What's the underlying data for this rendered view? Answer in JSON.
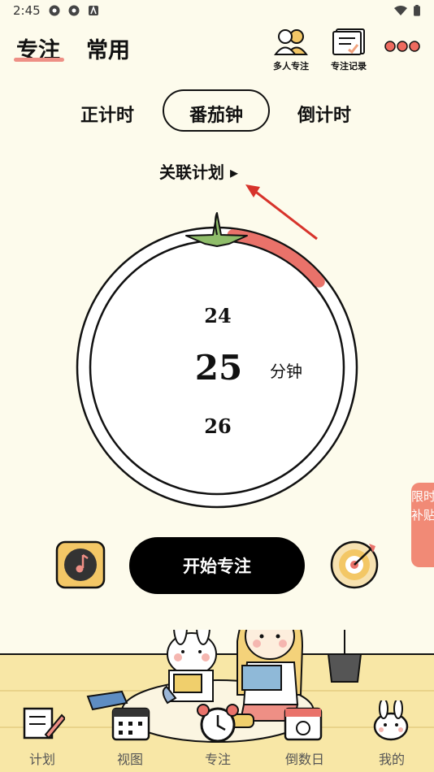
{
  "status_bar": {
    "time": "2:45"
  },
  "header": {
    "tabs": [
      {
        "label": "专注"
      },
      {
        "label": "常用"
      }
    ],
    "multi_person_label": "多人专注",
    "focus_record_label": "专注记录"
  },
  "modes": [
    {
      "label": "正计时"
    },
    {
      "label": "番茄钟"
    },
    {
      "label": "倒计时"
    }
  ],
  "linked_plan": "关联计划 ▸",
  "timer": {
    "prev": "24",
    "current": "25",
    "next": "26",
    "unit": "分钟",
    "progress": 0.12
  },
  "side_badge": "限时补贴",
  "start_button": "开始专注",
  "bottom_nav": [
    {
      "label": "计划"
    },
    {
      "label": "视图"
    },
    {
      "label": "专注"
    },
    {
      "label": "倒数日"
    },
    {
      "label": "我的"
    }
  ],
  "colors": {
    "accent": "#ee8f85",
    "ring_progress": "#e9726a",
    "leaf": "#8fbd6a",
    "background": "#fdfbec"
  }
}
